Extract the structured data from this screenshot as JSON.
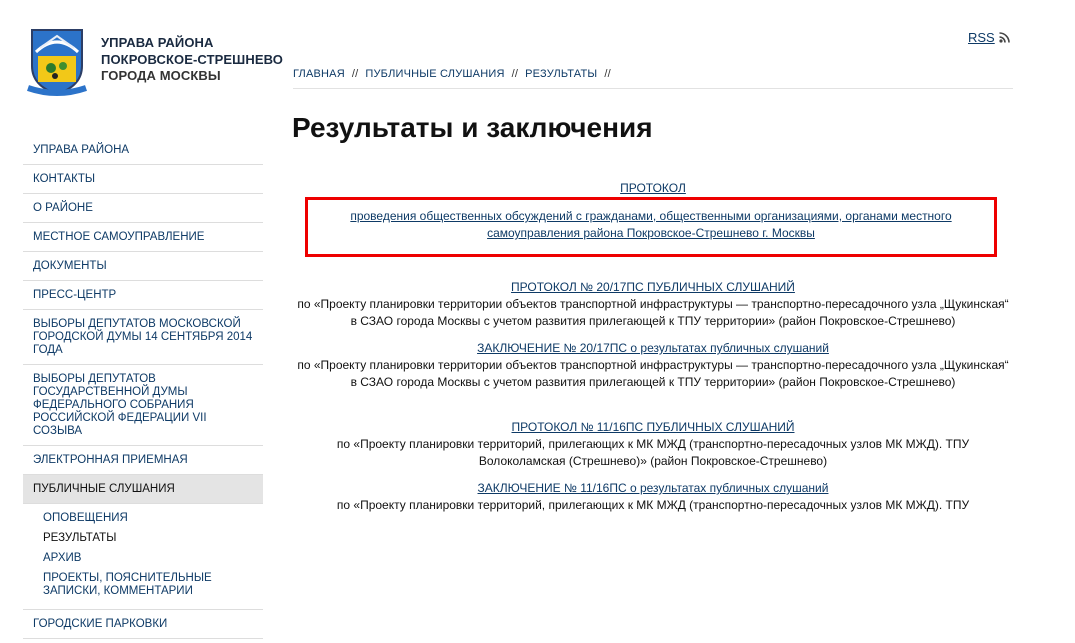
{
  "header": {
    "site_name": [
      "УПРАВА РАЙОНА",
      "ПОКРОВСКОЕ-СТРЕШНЕВО",
      "ГОРОДА МОСКВЫ"
    ],
    "rss_label": "RSS",
    "logo_caption": "ПОКРОВСКОЕ-СТРЕШНЕВО"
  },
  "breadcrumb": {
    "items": [
      "ГЛАВНАЯ",
      "ПУБЛИЧНЫЕ СЛУШАНИЯ",
      "РЕЗУЛЬТАТЫ"
    ],
    "separator": "//"
  },
  "page_title": "Результаты и заключения",
  "sidebar": {
    "items": [
      "УПРАВА РАЙОНА",
      "КОНТАКТЫ",
      "О РАЙОНЕ",
      "МЕСТНОЕ САМОУПРАВЛЕНИЕ",
      "ДОКУМЕНТЫ",
      "ПРЕСС-ЦЕНТР",
      "ВЫБОРЫ ДЕПУТАТОВ МОСКОВСКОЙ ГОРОДСКОЙ ДУМЫ 14 СЕНТЯБРЯ 2014 ГОДА",
      "ВЫБОРЫ ДЕПУТАТОВ ГОСУДАРСТВЕННОЙ ДУМЫ ФЕДЕРАЛЬНОГО СОБРАНИЯ РОССИЙСКОЙ ФЕДЕРАЦИИ VII СОЗЫВА",
      "ЭЛЕКТРОННАЯ ПРИЕМНАЯ",
      "ПУБЛИЧНЫЕ СЛУШАНИЯ"
    ],
    "sub_items": [
      "ОПОВЕЩЕНИЯ",
      "РЕЗУЛЬТАТЫ",
      "АРХИВ",
      "ПРОЕКТЫ, ПОЯСНИТЕЛЬНЫЕ ЗАПИСКИ, КОММЕНТАРИИ"
    ],
    "after_item": "ГОРОДСКИЕ ПАРКОВКИ"
  },
  "content": {
    "protocol_heading": "ПРОТОКОЛ",
    "protocol_link": " проведения общественных обсуждений с гражданами, общественными организациями, органами местного самоуправления района Покровское-Стрешнево г. Москвы",
    "blocks": [
      {
        "protocol": "ПРОТОКОЛ № 20/17ПС ПУБЛИЧНЫХ СЛУШАНИЙ",
        "protocol_desc": "по «Проекту планировки территории объектов транспортной инфраструктуры — транспортно-пересадочного узла „Щукинская“ в СЗАО города Москвы с учетом развития прилегающей к ТПУ территории» (район Покровское-Стрешнево)",
        "conclusion": "ЗАКЛЮЧЕНИЕ № 20/17ПС о результатах публичных слушаний",
        "conclusion_desc": "по «Проекту планировки территории объектов транспортной инфраструктуры — транспортно-пересадочного узла „Щукинская“ в СЗАО города Москвы с учетом развития прилегающей к ТПУ территории» (район Покровское-Стрешнево)"
      },
      {
        "protocol": "ПРОТОКОЛ № 11/16ПС ПУБЛИЧНЫХ СЛУШАНИЙ",
        "protocol_desc": "по «Проекту планировки территорий, прилегающих к МК МЖД (транспортно-пересадочных узлов МК МЖД). ТПУ Волоколамская (Стрешнево)» (район Покровское-Стрешнево)",
        "conclusion": "ЗАКЛЮЧЕНИЕ № 11/16ПС о результатах публичных слушаний",
        "conclusion_desc": "по «Проекту планировки территорий, прилегающих к МК МЖД (транспортно-пересадочных узлов МК МЖД). ТПУ"
      }
    ]
  },
  "colors": {
    "link": "#0e3a66",
    "highlight_border": "#ee0000",
    "active_bg": "#e4e4e4"
  }
}
